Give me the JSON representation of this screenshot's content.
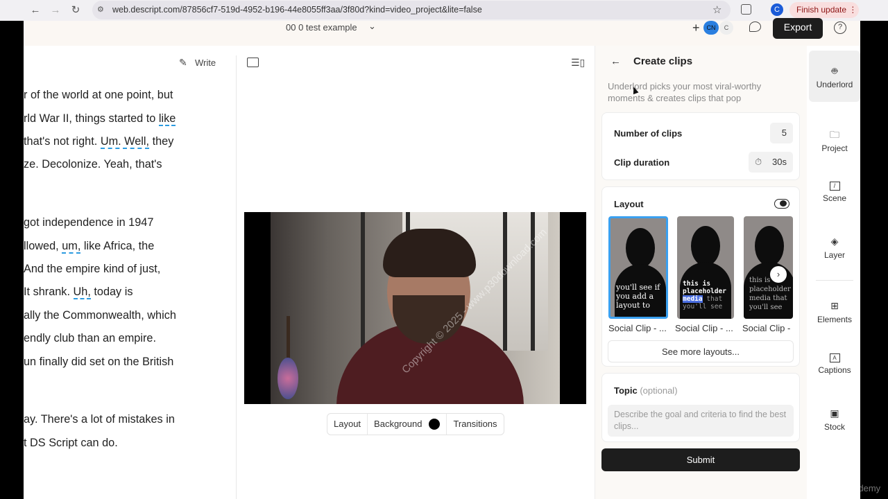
{
  "browser": {
    "url": "web.descript.com/87856cf7-519d-4952-b196-44e8055ff3aa/3f80d?kind=video_project&lite=false",
    "profile_initial": "C",
    "finish_update_label": "Finish update"
  },
  "header": {
    "project_title": "00 0 test example",
    "collaborator_1": "CN",
    "collaborator_2": "C",
    "export_label": "Export"
  },
  "transcript": {
    "write_label": "Write",
    "lines": [
      {
        "pre": "r of the world at one point, but",
        "mark": "",
        "post": ""
      },
      {
        "pre": "rld War II, things started to ",
        "mark": "like",
        "post": ""
      },
      {
        "pre": " that's not right. ",
        "mark": "Um. Well,",
        "post": " they"
      },
      {
        "pre": "ze. Decolonize. Yeah, that's",
        "mark": "",
        "post": ""
      },
      {
        "pre": " got independence in 1947",
        "mark": "",
        "post": ""
      },
      {
        "pre": "llowed, ",
        "mark": "um,",
        "post": " like Africa, the"
      },
      {
        "pre": " And the empire kind of just,",
        "mark": "",
        "post": ""
      },
      {
        "pre": "It shrank. ",
        "mark": "Uh,",
        "post": " today is"
      },
      {
        "pre": "ally the Commonwealth, which",
        "mark": "",
        "post": ""
      },
      {
        "pre": "endly club than an empire.",
        "mark": "",
        "post": ""
      },
      {
        "pre": "un finally did set on the British",
        "mark": "",
        "post": ""
      },
      {
        "pre": "ay. There's a lot of mistakes in",
        "mark": "",
        "post": ""
      },
      {
        "pre": "t DS Script can do.",
        "mark": "",
        "post": ""
      }
    ]
  },
  "video": {
    "watermark": "Copyright © 2025 - www.p30download.com",
    "toolbar": {
      "layout_label": "Layout",
      "background_label": "Background",
      "transitions_label": "Transitions"
    }
  },
  "clips_panel": {
    "title": "Create clips",
    "description": "Underlord picks your most viral-worthy moments & creates clips that pop",
    "number_of_clips_label": "Number of clips",
    "number_of_clips_value": "5",
    "clip_duration_label": "Clip duration",
    "clip_duration_value": "30s",
    "layout_label": "Layout",
    "layout_toggle_on": true,
    "thumbnails": [
      {
        "caption": "Social Clip - ...",
        "overlay": "you'll see if you add a layout to"
      },
      {
        "caption": "Social Clip - ...",
        "overlay_line1": "this is",
        "overlay_line2": "placeholder",
        "overlay_highlight": "media",
        "overlay_line3": " that",
        "overlay_line4": "you'll see"
      },
      {
        "caption": "Social Clip -",
        "overlay": "this is placeholder media that you'll see"
      }
    ],
    "see_more_label": "See more layouts...",
    "topic_label": "Topic",
    "topic_optional": "(optional)",
    "topic_placeholder": "Describe the goal and criteria to find the best clips...",
    "submit_label": "Submit"
  },
  "sidebar": {
    "items": [
      {
        "label": "Underlord",
        "icon": "robot-icon"
      },
      {
        "label": "Project",
        "icon": "folder-icon"
      },
      {
        "label": "Scene",
        "icon": "scene-icon"
      },
      {
        "label": "Layer",
        "icon": "layers-icon"
      },
      {
        "label": "Elements",
        "icon": "elements-icon"
      },
      {
        "label": "Captions",
        "icon": "captions-icon"
      },
      {
        "label": "Stock",
        "icon": "stock-icon"
      }
    ]
  },
  "overlay_brand": "Udemy",
  "colors": {
    "accent": "#3aa0f0",
    "finish_update_bg": "#f9dede",
    "primary_button": "#1d1d1d"
  }
}
